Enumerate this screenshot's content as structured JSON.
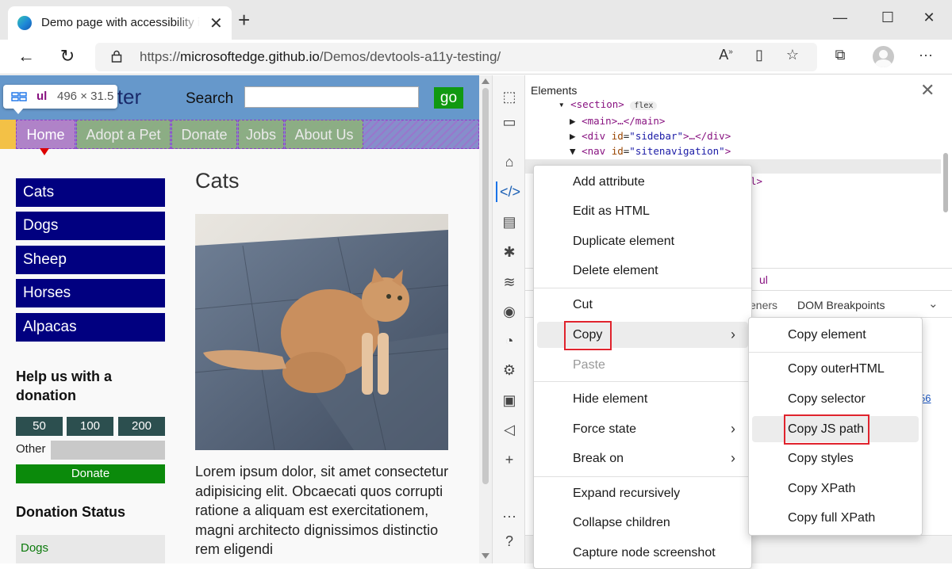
{
  "browser": {
    "tab_title": "Demo page with accessibility issues",
    "tab_close": "✕",
    "new_tab": "+",
    "url_prefix": "https://",
    "url_host": "microsoftedge.github.io",
    "url_path": "/Demos/devtools-a11y-testing/",
    "menu": "···"
  },
  "site": {
    "logo": "lter",
    "search_label": "Search",
    "search_value": "",
    "go_label": "go",
    "nav": [
      "Home",
      "Adopt a Pet",
      "Donate",
      "Jobs",
      "About Us"
    ],
    "sidebar": [
      "Cats",
      "Dogs",
      "Sheep",
      "Horses",
      "Alpacas"
    ],
    "help_heading": "Help us with a donation",
    "amounts": [
      "50",
      "100",
      "200"
    ],
    "other_label": "Other",
    "donate_label": "Donate",
    "status_heading": "Donation Status",
    "status_item": "Dogs",
    "main_title": "Cats",
    "lorem": "Lorem ipsum dolor, sit amet consectetur adipisicing elit. Obcaecati quos corrupti ratione a aliquam est exercitationem, magni architecto dignissimos distinctio rem eligendi"
  },
  "inspect_tooltip": {
    "tag": "ul",
    "size": "496 × 31.5"
  },
  "devtools": {
    "panel_title": "Elements",
    "close": "✕",
    "dom": {
      "section_tag": "<section>",
      "flex_badge": "flex",
      "main_line": "<main>…</main>",
      "sidebar_open": "<div ",
      "sidebar_attr": "id",
      "sidebar_val": "\"sidebar\"",
      "sidebar_close": ">…</div>",
      "nav_open": "<nav ",
      "nav_attr": "id",
      "nav_val": "\"sitenavigation\"",
      "nav_close": ">",
      "tail": "l>"
    },
    "breadcrumb_ul": "ul",
    "tab_listeners": "eners",
    "tab_dom_breakpoints": "DOM Breakpoints",
    "link_fragment": "56"
  },
  "context_menu": {
    "items": [
      {
        "label": "Add attribute"
      },
      {
        "label": "Edit as HTML"
      },
      {
        "label": "Duplicate element"
      },
      {
        "label": "Delete element"
      },
      {
        "label": "Cut"
      },
      {
        "label": "Copy"
      },
      {
        "label": "Paste"
      },
      {
        "label": "Hide element"
      },
      {
        "label": "Force state"
      },
      {
        "label": "Break on"
      },
      {
        "label": "Expand recursively"
      },
      {
        "label": "Collapse children"
      },
      {
        "label": "Capture node screenshot"
      }
    ]
  },
  "copy_submenu": {
    "items": [
      {
        "label": "Copy element"
      },
      {
        "label": "Copy outerHTML"
      },
      {
        "label": "Copy selector"
      },
      {
        "label": "Copy JS path"
      },
      {
        "label": "Copy styles"
      },
      {
        "label": "Copy XPath"
      },
      {
        "label": "Copy full XPath"
      }
    ]
  },
  "colors": {
    "site_header": "#6698cb",
    "sidebar_button": "#010080",
    "donate_green": "#0b8a0b",
    "highlight_red": "#e0232d",
    "devtools_accent": "#1a73e8"
  }
}
